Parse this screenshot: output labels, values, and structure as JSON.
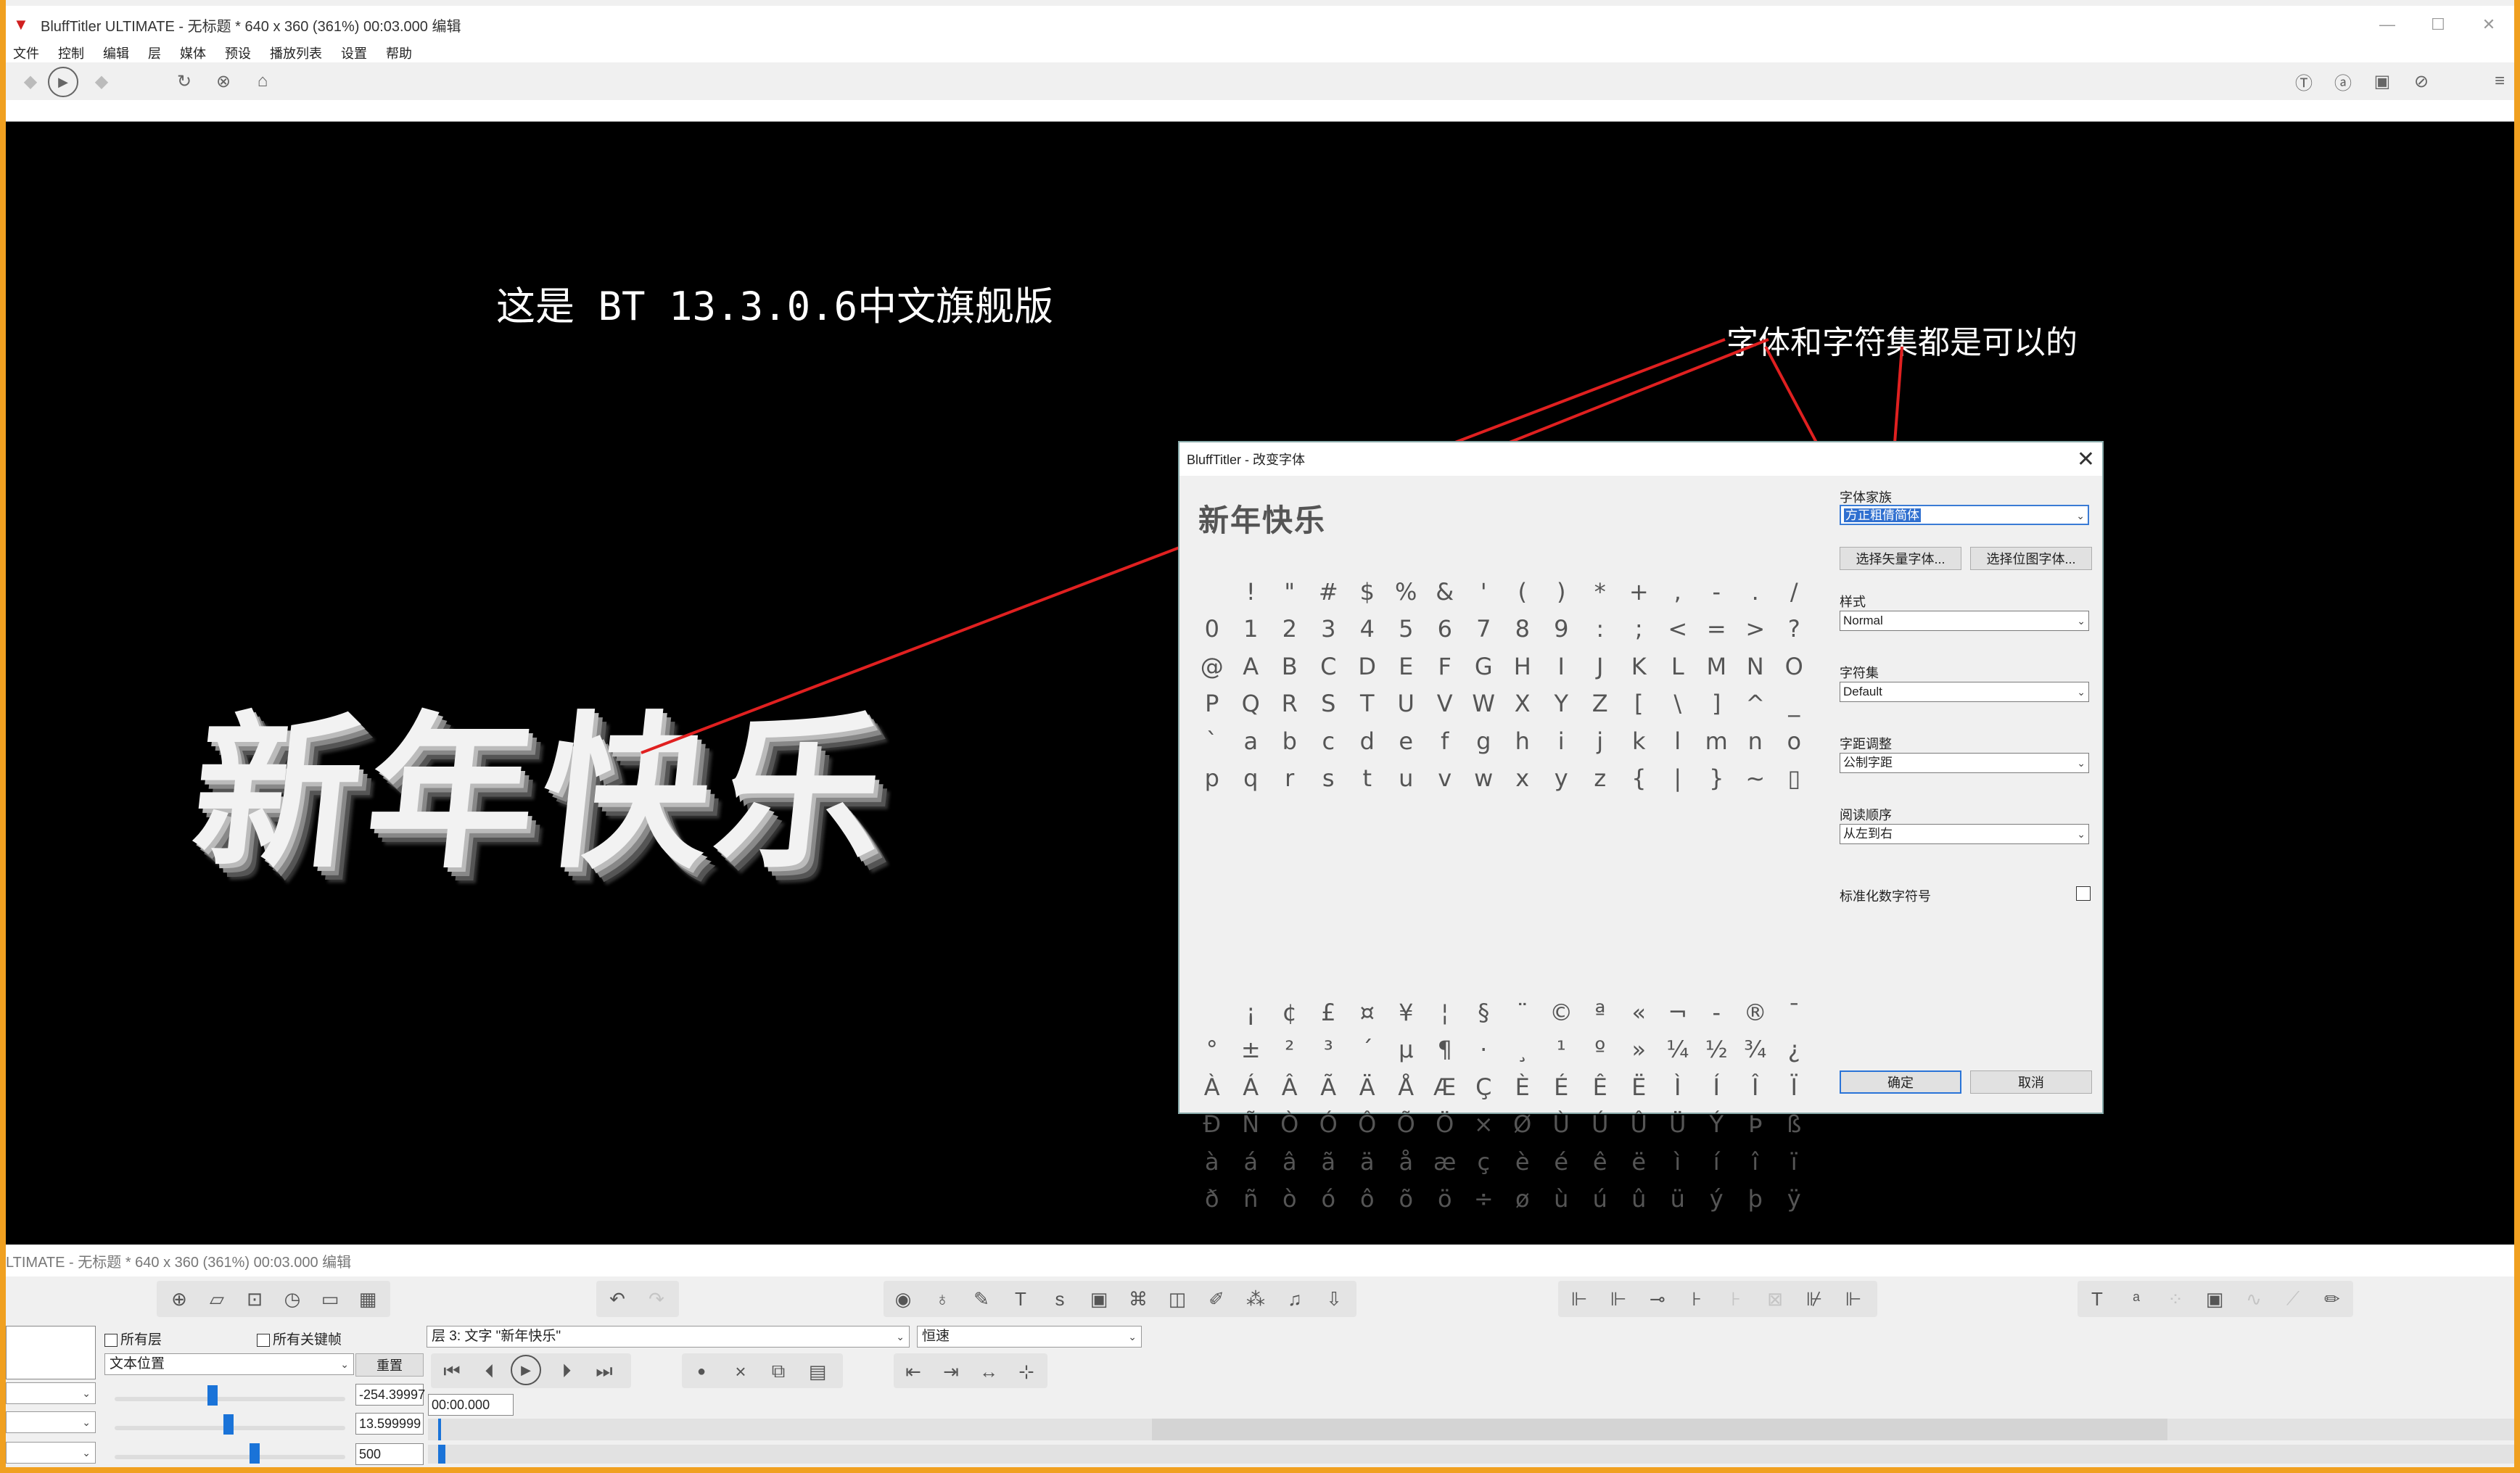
{
  "window": {
    "title": "BluffTitler ULTIMATE  - 无标题 * 640 x 360 (361%) 00:03.000 编辑",
    "app_icon": "app-logo-icon",
    "controls": [
      "—",
      "☐",
      "✕"
    ]
  },
  "menu": [
    "文件",
    "控制",
    "编辑",
    "层",
    "媒体",
    "预设",
    "播放列表",
    "设置",
    "帮助"
  ],
  "viewport": {
    "caption_version": "这是 BT 13.3.0.6中文旗舰版",
    "caption_note": "字体和字符集都是可以的",
    "main_text": "新年快乐",
    "annotation_color": "#e02020"
  },
  "font_dialog": {
    "title": "BluffTitler - 改变字体",
    "close": "✕",
    "preview": "新年快乐",
    "char_rows_1": [
      [
        " ",
        "!",
        "\"",
        "#",
        "$",
        "%",
        "&",
        "'",
        "(",
        ")",
        "*",
        "+",
        ",",
        "-",
        ".",
        "/"
      ],
      [
        "0",
        "1",
        "2",
        "3",
        "4",
        "5",
        "6",
        "7",
        "8",
        "9",
        ":",
        ";",
        "<",
        "=",
        ">",
        "?"
      ],
      [
        "@",
        "A",
        "B",
        "C",
        "D",
        "E",
        "F",
        "G",
        "H",
        "I",
        "J",
        "K",
        "L",
        "M",
        "N",
        "O"
      ],
      [
        "P",
        "Q",
        "R",
        "S",
        "T",
        "U",
        "V",
        "W",
        "X",
        "Y",
        "Z",
        "[",
        "\\",
        "]",
        "^",
        "_"
      ],
      [
        "`",
        "a",
        "b",
        "c",
        "d",
        "e",
        "f",
        "g",
        "h",
        "i",
        "j",
        "k",
        "l",
        "m",
        "n",
        "o"
      ],
      [
        "p",
        "q",
        "r",
        "s",
        "t",
        "u",
        "v",
        "w",
        "x",
        "y",
        "z",
        "{",
        "|",
        "}",
        "~",
        "▯"
      ]
    ],
    "char_rows_2": [
      [
        " ",
        "¡",
        "¢",
        "£",
        "¤",
        "¥",
        "¦",
        "§",
        "¨",
        "©",
        "ª",
        "«",
        "¬",
        "-",
        "®",
        "¯"
      ],
      [
        "°",
        "±",
        "²",
        "³",
        "´",
        "µ",
        "¶",
        "·",
        "¸",
        "¹",
        "º",
        "»",
        "¼",
        "½",
        "¾",
        "¿"
      ],
      [
        "À",
        "Á",
        "Â",
        "Ã",
        "Ä",
        "Å",
        "Æ",
        "Ç",
        "È",
        "É",
        "Ê",
        "Ë",
        "Ì",
        "Í",
        "Î",
        "Ï"
      ],
      [
        "Đ",
        "Ñ",
        "Ò",
        "Ó",
        "Ô",
        "Õ",
        "Ö",
        "×",
        "Ø",
        "Ù",
        "Ú",
        "Û",
        "Ü",
        "Ý",
        "Þ",
        "ß"
      ],
      [
        "à",
        "á",
        "â",
        "ã",
        "ä",
        "å",
        "æ",
        "ç",
        "è",
        "é",
        "ê",
        "ë",
        "ì",
        "í",
        "î",
        "ï"
      ],
      [
        "ð",
        "ñ",
        "ò",
        "ó",
        "ô",
        "õ",
        "ö",
        "÷",
        "ø",
        "ù",
        "ú",
        "û",
        "ü",
        "ý",
        "þ",
        "ÿ"
      ]
    ],
    "font_family_label": "字体家族",
    "font_family_value": "方正粗倩简体",
    "btn_vector_font": "选择矢量字体...",
    "btn_bitmap_font": "选择位图字体...",
    "style_label": "样式",
    "style_value": "Normal",
    "charset_label": "字符集",
    "charset_value": "Default",
    "spacing_label": "字距调整",
    "spacing_value": "公制字距",
    "reading_label": "阅读顺序",
    "reading_value": "从左到右",
    "normalize_label": "标准化数字符号",
    "ok": "确定",
    "cancel": "取消"
  },
  "status_title": "LTIMATE  - 无标题 * 640 x 360 (361%) 00:03.000 编辑",
  "bottom": {
    "all_layers": "所有层",
    "all_keyframes": "所有关键帧",
    "property": "文本位置",
    "reset": "重置",
    "layer_select": "层 3: 文字 \"新年快乐\"",
    "speed_select": "恒速",
    "value_x": "-254.39997",
    "value_y": "13.599999",
    "value_z": "500",
    "time": "00:00.000"
  }
}
